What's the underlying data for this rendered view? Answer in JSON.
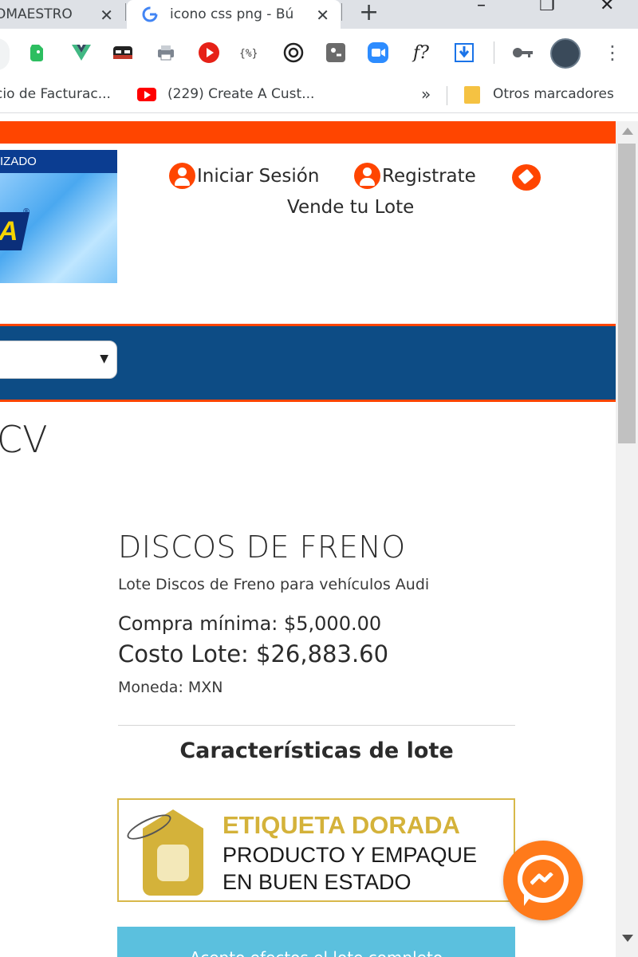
{
  "browser": {
    "tabs": [
      {
        "title": "OMAESTRO",
        "close": "✕"
      },
      {
        "title": "icono css png - Bú",
        "close": "✕",
        "favicon": "google-icon"
      }
    ],
    "new_tab": "+",
    "window_controls": {
      "minimize": "–",
      "maximize": "❐",
      "close": "✕"
    },
    "extensions": [
      "evernote-icon",
      "vue-icon",
      "mask-icon",
      "print-icon",
      "cast-icon",
      "play-icon",
      "code-icon",
      "openai-icon",
      "toggle-icon",
      "zoom-icon",
      "formula-icon",
      "download-icon",
      "key-icon"
    ],
    "formula_label": "f?",
    "bookmarks": [
      {
        "label": "cio de Facturac..."
      },
      {
        "label": "(229) Create A Cust..."
      }
    ],
    "bookmarks_overflow": "»",
    "other_bookmarks": "Otros marcadores"
  },
  "header": {
    "logo_band": "IZADO",
    "logo_mark": "A",
    "logo_reg": "®",
    "login": "Iniciar Sesión",
    "register": "Registrate",
    "sell": "Vende tu Lote"
  },
  "nav": {
    "select_arrow": "▼"
  },
  "company_suffix": "CV",
  "product": {
    "title": "DISCOS DE FRENO",
    "description": "Lote Discos de Freno para vehículos Audi",
    "min_purchase": "Compra mínima: $5,000.00",
    "lot_cost": "Costo Lote: $26,883.60",
    "currency": "Moneda: MXN",
    "features_title": "Características de lote"
  },
  "badge": {
    "head": "ETIQUETA DORADA",
    "line1": "PRODUCTO Y EMPAQUE",
    "line2": "EN BUEN ESTADO"
  },
  "cta": {
    "label": "Acepto efectos el lote completo"
  },
  "colors": {
    "accent_orange": "#ff4500",
    "nav_blue": "#0d4c85",
    "gold": "#d4b23a",
    "cta_blue": "#5bc0de",
    "messenger_orange": "#ff7a1a"
  }
}
